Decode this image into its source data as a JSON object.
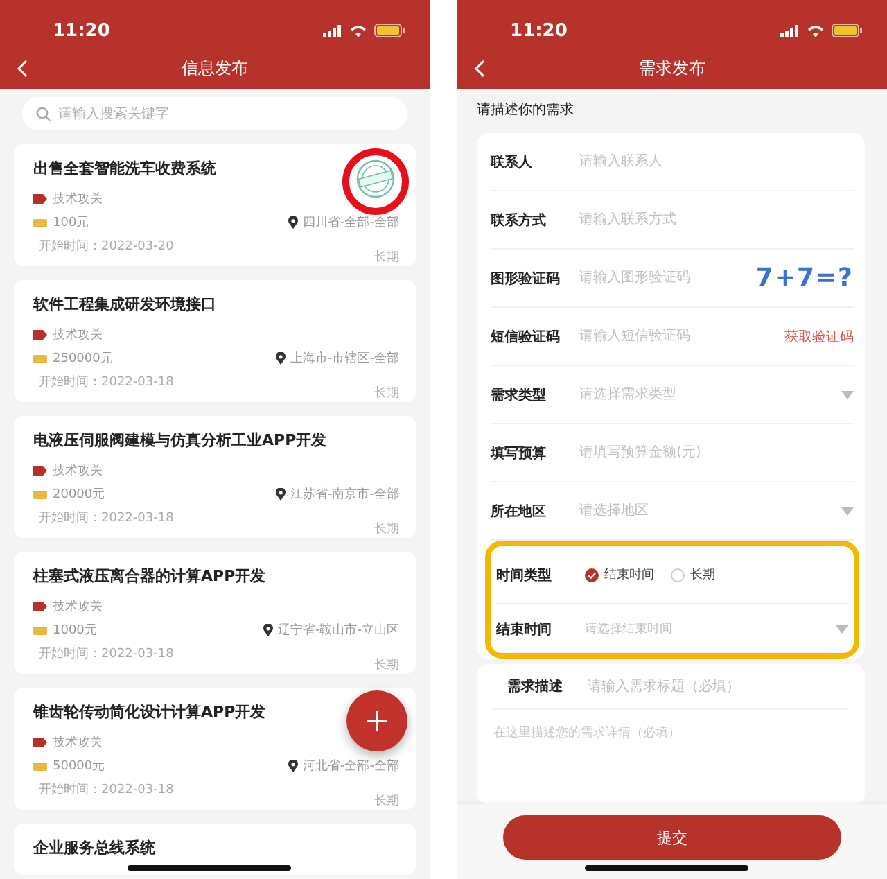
{
  "left_screen": {
    "status_bar": {
      "time": "11:20"
    },
    "title": "信息发布",
    "search": {
      "placeholder": "请输入搜索关键字"
    },
    "listings": [
      {
        "title": "出售全套智能洗车收费系统",
        "tag": "技术攻关",
        "budget": "100元",
        "location": "四川省-全部-全部",
        "start": "开始时间：2022-03-20",
        "duration": "长期",
        "stamped": true,
        "circled": true
      },
      {
        "title": "软件工程集成研发环境接口",
        "tag": "技术攻关",
        "budget": "250000元",
        "location": "上海市-市辖区-全部",
        "start": "开始时间：2022-03-18",
        "duration": "长期",
        "stamped": false,
        "circled": false
      },
      {
        "title": "电液压伺服阀建模与仿真分析工业APP开发",
        "tag": "技术攻关",
        "budget": "20000元",
        "location": "江苏省-南京市-全部",
        "start": "开始时间：2022-03-18",
        "duration": "长期",
        "stamped": false,
        "circled": false
      },
      {
        "title": "柱塞式液压离合器的计算APP开发",
        "tag": "技术攻关",
        "budget": "1000元",
        "location": "辽宁省-鞍山市-立山区",
        "start": "开始时间：2022-03-18",
        "duration": "长期",
        "stamped": false,
        "circled": false
      },
      {
        "title": "锥齿轮传动简化设计计算APP开发",
        "tag": "技术攻关",
        "budget": "50000元",
        "location": "河北省-全部-全部",
        "start": "开始时间：2022-03-18",
        "duration": "长期",
        "stamped": false,
        "circled": false
      },
      {
        "title": "企业服务总线系统",
        "stamped": false,
        "circled": false
      }
    ]
  },
  "right_screen": {
    "status_bar": {
      "time": "11:20"
    },
    "title": "需求发布",
    "section_label": "请描述你的需求",
    "fields": [
      {
        "kind": "text",
        "label": "联系人",
        "placeholder": "请输入联系人"
      },
      {
        "kind": "text",
        "label": "联系方式",
        "placeholder": "请输入联系方式"
      },
      {
        "kind": "captcha",
        "label": "图形验证码",
        "placeholder": "请输入图形验证码",
        "captcha": "7+7=?"
      },
      {
        "kind": "sms",
        "label": "短信验证码",
        "placeholder": "请输入短信验证码",
        "action": "获取验证码"
      },
      {
        "kind": "select",
        "label": "需求类型",
        "placeholder": "请选择需求类型"
      },
      {
        "kind": "text",
        "label": "填写预算",
        "placeholder": "请填写预算金额(元)"
      },
      {
        "kind": "select",
        "label": "所在地区",
        "placeholder": "请选择地区"
      }
    ],
    "time_group": {
      "highlighted": true,
      "fields": [
        {
          "kind": "radio",
          "label": "时间类型",
          "options": [
            {
              "label": "结束时间",
              "selected": true
            },
            {
              "label": "长期",
              "selected": false
            }
          ]
        },
        {
          "kind": "select",
          "label": "结束时间",
          "placeholder": "请选择结束时间"
        }
      ]
    },
    "description": {
      "label": "需求描述",
      "title_placeholder": "请输入需求标题（必填）",
      "detail_placeholder": "在这里描述您的需求详情（必填）"
    },
    "submit": "提交"
  }
}
